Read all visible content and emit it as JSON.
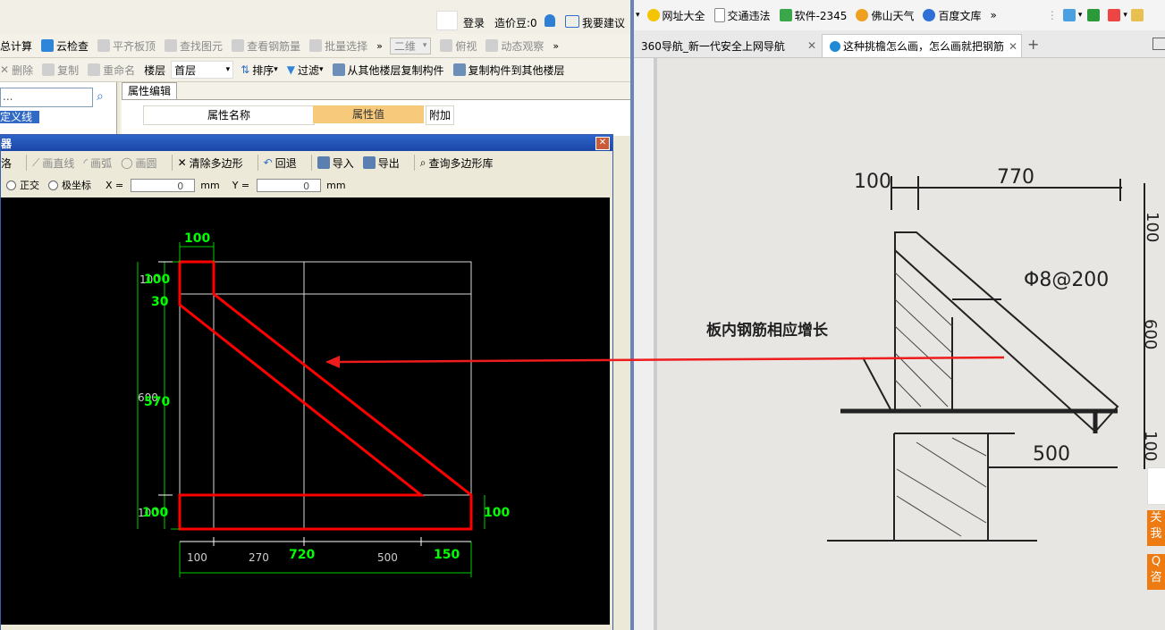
{
  "top_strip": {
    "login": "登录",
    "price_beans": "造价豆:0",
    "suggest": "我要建议"
  },
  "toolbar1": {
    "calc": "总计算",
    "cloud_check": "云检查",
    "level_slab": "平齐板顶",
    "find_elem": "查找图元",
    "view_rebar": "查看钢筋量",
    "batch_select": "批量选择",
    "view_mode": "二维",
    "top_view": "俯视",
    "dynamic_view": "动态观察"
  },
  "toolbar2": {
    "delete": "删除",
    "copy": "复制",
    "rename": "重命名",
    "floor_label": "楼层",
    "floor_value": "首层",
    "sort": "排序",
    "filter": "过滤",
    "copy_from": "从其他楼层复制构件",
    "copy_to": "复制构件到其他楼层"
  },
  "nav": {
    "search_placeholder": "...",
    "selected_item": "自定义线"
  },
  "props": {
    "tab": "属性编辑",
    "col_name": "属性名称",
    "col_value": "属性值",
    "col_extra": "附加"
  },
  "dialog": {
    "title": "器",
    "tools": {
      "first": "洛",
      "draw_line": "画直线",
      "draw_arc": "画弧",
      "draw_circle": "画圆",
      "clear": "清除多边形",
      "undo": "回退",
      "import": "导入",
      "export": "导出",
      "query": "查询多边形库"
    },
    "coord": {
      "ortho": "正交",
      "polar": "极坐标",
      "x_label": "X =",
      "x_value": "0",
      "y_label": "Y =",
      "y_value": "0",
      "unit": "mm"
    },
    "dims": {
      "top_width": "100",
      "left_100a": "100",
      "left_100b": "100",
      "left_30": "30",
      "left_600": "600",
      "left_570": "570",
      "left_100c": "100",
      "left_100d": "100",
      "right_100": "100",
      "bottom_100": "100",
      "bottom_270": "270",
      "bottom_720": "720",
      "bottom_500": "500",
      "bottom_150": "150"
    }
  },
  "browser": {
    "bookmarks": [
      "网址大全",
      "交通违法",
      "软件-2345",
      "佛山天气",
      "百度文库"
    ],
    "tabs": [
      "360导航_新一代安全上网导航",
      "这种挑檐怎么画，怎么画就把钢筋"
    ],
    "photo_labels": {
      "dim_100": "100",
      "dim_770": "770",
      "rebar": "Φ8@200",
      "note": "板内钢筋相应增长",
      "dim_500": "500",
      "right_100": "100",
      "right_600": "600",
      "right_100b": "100"
    },
    "side_buttons": [
      "关\n我",
      "Q\n咨"
    ]
  },
  "colors": {
    "accent_red": "#ff0000",
    "dim_green": "#00cc00",
    "title_blue": "#2e64c8"
  }
}
